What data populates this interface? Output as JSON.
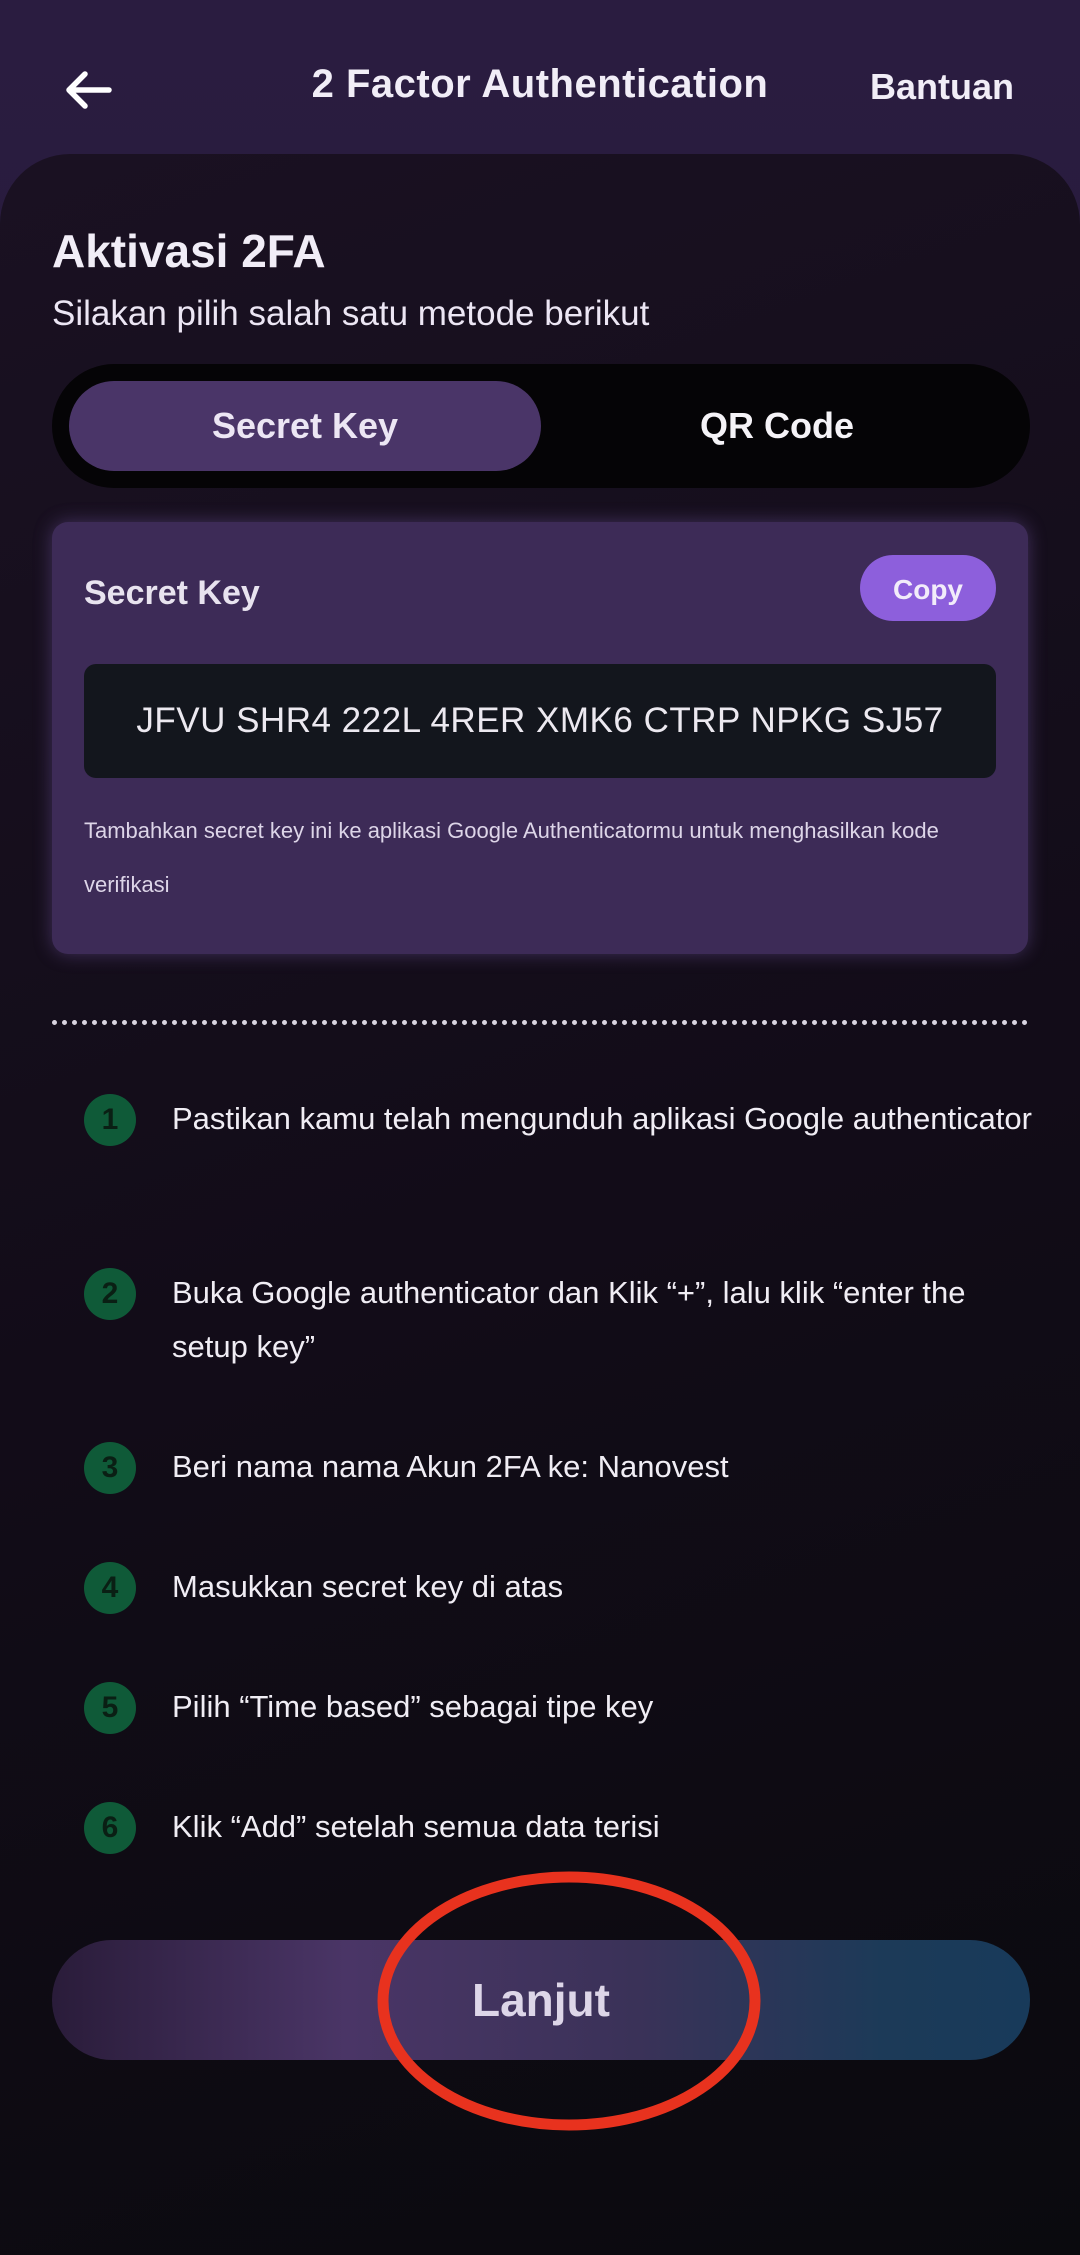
{
  "header": {
    "title": "2 Factor Authentication",
    "help_label": "Bantuan"
  },
  "main": {
    "title": "Aktivasi 2FA",
    "subtitle": "Silakan pilih salah satu metode berikut",
    "tabs": [
      {
        "label": "Secret Key",
        "active": true
      },
      {
        "label": "QR Code",
        "active": false
      }
    ],
    "key_card": {
      "label": "Secret Key",
      "copy_label": "Copy",
      "secret_key": "JFVU SHR4 222L 4RER XMK6 CTRP NPKG SJ57",
      "hint": "Tambahkan secret key ini ke aplikasi Google Authenticatormu untuk menghasilkan kode verifikasi"
    },
    "steps": [
      {
        "number": "1",
        "text": "Pastikan kamu telah mengunduh aplikasi Google authenticator"
      },
      {
        "number": "2",
        "text": "Buka Google authenticator dan Klik “+”, lalu klik “enter the setup key”"
      },
      {
        "number": "3",
        "text": "Beri nama nama Akun 2FA ke: Nanovest"
      },
      {
        "number": "4",
        "text": "Masukkan secret key di atas"
      },
      {
        "number": "5",
        "text": "Pilih “Time based” sebagai tipe key"
      },
      {
        "number": "6",
        "text": "Klik “Add” setelah semua data terisi"
      }
    ],
    "cta_label": "Lanjut"
  },
  "colors": {
    "accent": "#8d5fdc",
    "step_badge": "#0f5a38",
    "annotation_circle": "#e8321e"
  },
  "icons": {
    "back": "arrow-left-icon"
  }
}
